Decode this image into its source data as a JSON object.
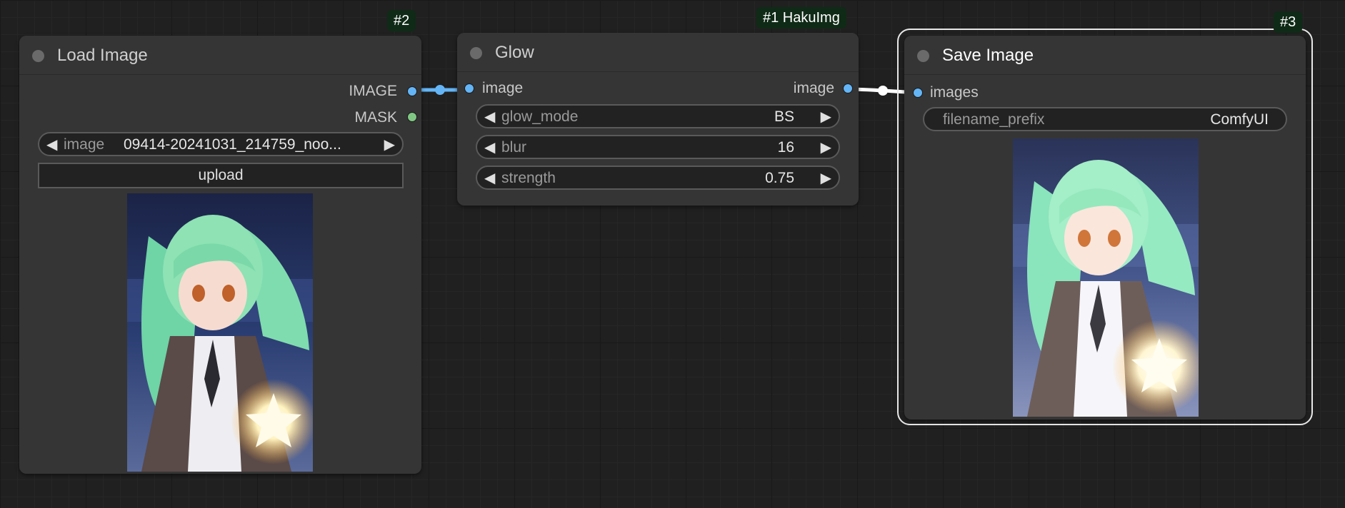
{
  "nodes": {
    "load_image": {
      "badge": "#2",
      "title": "Load Image",
      "outputs": [
        "IMAGE",
        "MASK"
      ],
      "image_label": "image",
      "image_value": "09414-20241031_214759_noo...",
      "upload_label": "upload"
    },
    "glow": {
      "badge": "#1 HakuImg",
      "title": "Glow",
      "input": "image",
      "output": "image",
      "widgets": [
        {
          "label": "glow_mode",
          "value": "BS"
        },
        {
          "label": "blur",
          "value": "16"
        },
        {
          "label": "strength",
          "value": "0.75"
        }
      ]
    },
    "save_image": {
      "badge": "#3",
      "title": "Save Image",
      "input": "images",
      "prefix_label": "filename_prefix",
      "prefix_value": "ComfyUI"
    }
  },
  "icons": {
    "arrow_left": "◀",
    "arrow_right": "▶"
  },
  "colors": {
    "image_port": "#64b5f6",
    "mask_port": "#81c784",
    "badge_bg": "#0f2a16",
    "selected_outline": "#e8e8e8"
  }
}
